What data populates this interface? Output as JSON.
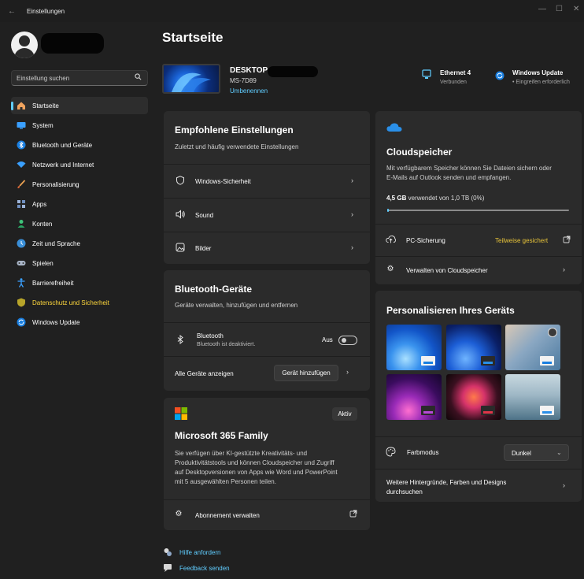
{
  "window": {
    "title": "Einstellungen",
    "back_glyph": "←",
    "minimize_glyph": "—",
    "maximize_glyph": "☐",
    "close_glyph": "✕"
  },
  "sidebar": {
    "search_placeholder": "Einstellung suchen",
    "search_icon": "search-icon",
    "items": [
      {
        "label": "Startseite",
        "icon": "home-icon",
        "active": true
      },
      {
        "label": "System",
        "icon": "monitor-icon"
      },
      {
        "label": "Bluetooth und Geräte",
        "icon": "bluetooth-icon"
      },
      {
        "label": "Netzwerk und Internet",
        "icon": "wifi-icon"
      },
      {
        "label": "Personalisierung",
        "icon": "brush-icon"
      },
      {
        "label": "Apps",
        "icon": "apps-icon"
      },
      {
        "label": "Konten",
        "icon": "account-icon"
      },
      {
        "label": "Zeit und Sprache",
        "icon": "globe-clock-icon"
      },
      {
        "label": "Spielen",
        "icon": "gamepad-icon"
      },
      {
        "label": "Barrierefreiheit",
        "icon": "accessibility-icon"
      },
      {
        "label": "Datenschutz und Sicherheit",
        "icon": "shield-icon",
        "highlight": true
      },
      {
        "label": "Windows Update",
        "icon": "update-icon"
      }
    ]
  },
  "main": {
    "title": "Startseite",
    "device": {
      "name": "DESKTOP",
      "model": "MS-7D89",
      "rename": "Umbenennen"
    },
    "status": {
      "network": {
        "title": "Ethernet 4",
        "sub": "Verbunden"
      },
      "update": {
        "title": "Windows Update",
        "sub": "• Eingreifen erforderlich"
      }
    },
    "recommended": {
      "title": "Empfohlene Einstellungen",
      "subtitle": "Zuletzt und häufig verwendete Einstellungen",
      "rows": [
        {
          "label": "Windows-Sicherheit",
          "icon": "shield-outline-icon"
        },
        {
          "label": "Sound",
          "icon": "speaker-icon"
        },
        {
          "label": "Bilder",
          "icon": "image-icon"
        }
      ]
    },
    "bluetooth": {
      "title": "Bluetooth-Geräte",
      "subtitle": "Geräte verwalten, hinzufügen und entfernen",
      "toggle_label": "Bluetooth",
      "toggle_sub": "Bluetooth ist deaktiviert.",
      "toggle_state": "Aus",
      "all_devices": "Alle Geräte anzeigen",
      "add_device": "Gerät hinzufügen"
    },
    "m365": {
      "badge": "Aktiv",
      "title": "Microsoft 365 Family",
      "body_lines": [
        "Sie verfügen über KI-gestützte Kreativitäts- und",
        "Produktivitätstools und können Cloudspeicher und Zugriff",
        "auf Desktopversionen von Apps wie Word und PowerPoint",
        "mit 5 ausgewählten Personen teilen."
      ],
      "manage": "Abonnement verwalten"
    },
    "cloud": {
      "title": "Cloudspeicher",
      "body_lines": [
        "Mit verfügbarem Speicher können Sie Dateien sichern oder",
        "E-Mails auf Outlook senden und empfangen."
      ],
      "used_bold": "4,5 GB",
      "used_rest": "verwendet von 1,0 TB (0%)",
      "used_fraction": 0.005,
      "backup_label": "PC-Sicherung",
      "backup_status": "Teilweise gesichert",
      "manage_label": "Verwalten von Cloudspeicher"
    },
    "personalize": {
      "title": "Personalisieren Ihres Geräts",
      "color_mode_label": "Farbmodus",
      "color_mode_value": "Dunkel",
      "more_lines": [
        "Weitere Hintergründe, Farben und Designs",
        "durchsuchen"
      ]
    },
    "links": {
      "help": "Hilfe anfordern",
      "feedback": "Feedback senden"
    }
  },
  "colors": {
    "accent": "#60cdff",
    "highlight": "#ffd83c",
    "warning": "#e8c43a"
  }
}
